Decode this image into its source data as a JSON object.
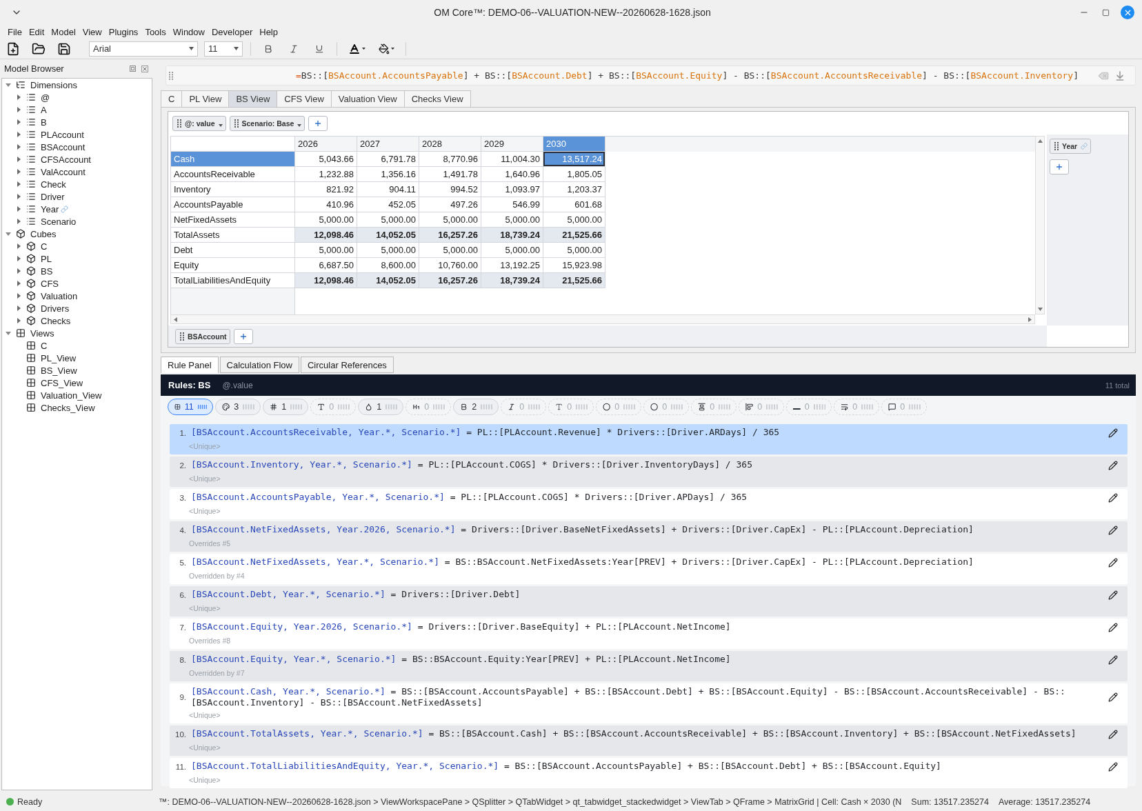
{
  "window": {
    "title": "OM Core™: DEMO-06--VALUATION-NEW--20260628-1628.json"
  },
  "menu": [
    "File",
    "Edit",
    "Model",
    "View",
    "Plugins",
    "Tools",
    "Window",
    "Developer",
    "Help"
  ],
  "toolbar": {
    "font": "Arial",
    "font_size": "11"
  },
  "model_browser": {
    "title": "Model Browser",
    "tree": [
      {
        "label": "Dimensions",
        "kind": "dimensions",
        "expanded": true,
        "children": [
          {
            "label": "@",
            "kind": "dimension",
            "expanded": false,
            "linked": false
          },
          {
            "label": "A",
            "kind": "dimension",
            "expanded": false,
            "linked": false
          },
          {
            "label": "B",
            "kind": "dimension",
            "expanded": false,
            "linked": false
          },
          {
            "label": "PLAccount",
            "kind": "dimension",
            "expanded": false,
            "linked": false
          },
          {
            "label": "BSAccount",
            "kind": "dimension",
            "expanded": false,
            "linked": false
          },
          {
            "label": "CFSAccount",
            "kind": "dimension",
            "expanded": false,
            "linked": false
          },
          {
            "label": "ValAccount",
            "kind": "dimension",
            "expanded": false,
            "linked": false
          },
          {
            "label": "Check",
            "kind": "dimension",
            "expanded": false,
            "linked": false
          },
          {
            "label": "Driver",
            "kind": "dimension",
            "expanded": false,
            "linked": false
          },
          {
            "label": "Year",
            "kind": "dimension",
            "expanded": false,
            "linked": true
          },
          {
            "label": "Scenario",
            "kind": "dimension",
            "expanded": false,
            "linked": false
          }
        ]
      },
      {
        "label": "Cubes",
        "kind": "cubes",
        "expanded": true,
        "children": [
          {
            "label": "C",
            "kind": "cube",
            "expanded": false
          },
          {
            "label": "PL",
            "kind": "cube",
            "expanded": false
          },
          {
            "label": "BS",
            "kind": "cube",
            "expanded": false
          },
          {
            "label": "CFS",
            "kind": "cube",
            "expanded": false
          },
          {
            "label": "Valuation",
            "kind": "cube",
            "expanded": false
          },
          {
            "label": "Drivers",
            "kind": "cube",
            "expanded": false
          },
          {
            "label": "Checks",
            "kind": "cube",
            "expanded": false
          }
        ]
      },
      {
        "label": "Views",
        "kind": "views",
        "expanded": true,
        "children": [
          {
            "label": "C",
            "kind": "view"
          },
          {
            "label": "PL_View",
            "kind": "view"
          },
          {
            "label": "BS_View",
            "kind": "view"
          },
          {
            "label": "CFS_View",
            "kind": "view"
          },
          {
            "label": "Valuation_View",
            "kind": "view"
          },
          {
            "label": "Checks_View",
            "kind": "view"
          }
        ]
      }
    ]
  },
  "formula_bar": {
    "tokens": [
      {
        "text": "=",
        "kind": "operator"
      },
      {
        "text": "BS::[",
        "kind": "plain"
      },
      {
        "text": "BSAccount.AccountsPayable",
        "kind": "reference"
      },
      {
        "text": "] + BS::[",
        "kind": "plain"
      },
      {
        "text": "BSAccount.Debt",
        "kind": "reference"
      },
      {
        "text": "] + BS::[",
        "kind": "plain"
      },
      {
        "text": "BSAccount.Equity",
        "kind": "reference"
      },
      {
        "text": "] - BS::[",
        "kind": "plain"
      },
      {
        "text": "BSAccount.AccountsReceivable",
        "kind": "reference"
      },
      {
        "text": "] - BS::[",
        "kind": "plain"
      },
      {
        "text": "BSAccount.Inventory",
        "kind": "reference"
      },
      {
        "text": "]",
        "kind": "plain"
      }
    ]
  },
  "view_tabs": [
    {
      "label": "C",
      "selected": false
    },
    {
      "label": "PL View",
      "selected": false
    },
    {
      "label": "BS View",
      "selected": true
    },
    {
      "label": "CFS View",
      "selected": false
    },
    {
      "label": "Valuation View",
      "selected": false
    },
    {
      "label": "Checks View",
      "selected": false
    }
  ],
  "pivot": {
    "filters": [
      {
        "label": "@: value"
      },
      {
        "label": "Scenario: Base"
      }
    ],
    "column_axis": [
      {
        "label": "Year",
        "linked": true
      }
    ],
    "row_axis": [
      {
        "label": "BSAccount"
      }
    ],
    "columns": [
      {
        "label": "2026",
        "selected": false
      },
      {
        "label": "2027",
        "selected": false
      },
      {
        "label": "2028",
        "selected": false
      },
      {
        "label": "2029",
        "selected": false
      },
      {
        "label": "2030",
        "selected": true
      }
    ],
    "rows": [
      {
        "label": "Cash",
        "selected": true,
        "total": false,
        "values": [
          "5,043.66",
          "6,791.78",
          "8,770.96",
          "11,004.30",
          "13,517.24"
        ]
      },
      {
        "label": "AccountsReceivable",
        "selected": false,
        "total": false,
        "values": [
          "1,232.88",
          "1,356.16",
          "1,491.78",
          "1,640.96",
          "1,805.05"
        ]
      },
      {
        "label": "Inventory",
        "selected": false,
        "total": false,
        "values": [
          "821.92",
          "904.11",
          "994.52",
          "1,093.97",
          "1,203.37"
        ]
      },
      {
        "label": "AccountsPayable",
        "selected": false,
        "total": false,
        "values": [
          "410.96",
          "452.05",
          "497.26",
          "546.99",
          "601.68"
        ]
      },
      {
        "label": "NetFixedAssets",
        "selected": false,
        "total": false,
        "values": [
          "5,000.00",
          "5,000.00",
          "5,000.00",
          "5,000.00",
          "5,000.00"
        ]
      },
      {
        "label": "TotalAssets",
        "selected": false,
        "total": true,
        "values": [
          "12,098.46",
          "14,052.05",
          "16,257.26",
          "18,739.24",
          "21,525.66"
        ]
      },
      {
        "label": "Debt",
        "selected": false,
        "total": false,
        "values": [
          "5,000.00",
          "5,000.00",
          "5,000.00",
          "5,000.00",
          "5,000.00"
        ]
      },
      {
        "label": "Equity",
        "selected": false,
        "total": false,
        "values": [
          "6,687.50",
          "8,600.00",
          "10,760.00",
          "13,192.25",
          "15,923.98"
        ]
      },
      {
        "label": "TotalLiabilitiesAndEquity",
        "selected": false,
        "total": true,
        "values": [
          "12,098.46",
          "14,052.05",
          "16,257.26",
          "18,739.24",
          "21,525.66"
        ]
      }
    ]
  },
  "bottom_tabs": [
    {
      "label": "Rule Panel",
      "selected": true
    },
    {
      "label": "Calculation Flow",
      "selected": false
    },
    {
      "label": "Circular References",
      "selected": false
    }
  ],
  "rules": {
    "title": "Rules: BS",
    "scope": "@.value",
    "total": "11 total",
    "filters": [
      {
        "kind": "grid",
        "count": "11",
        "selected": true,
        "disabled": false
      },
      {
        "kind": "palette",
        "count": "3",
        "selected": false,
        "disabled": false
      },
      {
        "kind": "number",
        "count": "1",
        "selected": false,
        "disabled": false
      },
      {
        "kind": "text",
        "count": "0",
        "selected": false,
        "disabled": true
      },
      {
        "kind": "fill",
        "count": "1",
        "selected": false,
        "disabled": false
      },
      {
        "kind": "heading",
        "count": "0",
        "selected": false,
        "disabled": true
      },
      {
        "kind": "bold",
        "count": "2",
        "selected": false,
        "disabled": false
      },
      {
        "kind": "italic",
        "count": "0",
        "selected": false,
        "disabled": true
      },
      {
        "kind": "font",
        "count": "0",
        "selected": false,
        "disabled": true
      },
      {
        "kind": "border",
        "count": "0",
        "selected": false,
        "disabled": true
      },
      {
        "kind": "shape",
        "count": "0",
        "selected": false,
        "disabled": true
      },
      {
        "kind": "valign",
        "count": "0",
        "selected": false,
        "disabled": true
      },
      {
        "kind": "halign",
        "count": "0",
        "selected": false,
        "disabled": true
      },
      {
        "kind": "underscore",
        "count": "0",
        "selected": false,
        "disabled": true
      },
      {
        "kind": "wrap",
        "count": "0",
        "selected": false,
        "disabled": true
      },
      {
        "kind": "comment",
        "count": "0",
        "selected": false,
        "disabled": true
      }
    ],
    "items": [
      {
        "number": "1.",
        "selector": "[BSAccount.AccountsReceivable, Year.*, Scenario.*]",
        "expression": "= PL::[PLAccount.Revenue] * Drivers::[Driver.ARDays] / 365",
        "note": "<Unique>",
        "selected": true
      },
      {
        "number": "2.",
        "selector": "[BSAccount.Inventory, Year.*, Scenario.*]",
        "expression": "= PL::[PLAccount.COGS] * Drivers::[Driver.InventoryDays] / 365",
        "note": "<Unique>",
        "selected": false
      },
      {
        "number": "3.",
        "selector": "[BSAccount.AccountsPayable, Year.*, Scenario.*]",
        "expression": "= PL::[PLAccount.COGS] * Drivers::[Driver.APDays] / 365",
        "note": "<Unique>",
        "selected": false
      },
      {
        "number": "4.",
        "selector": "[BSAccount.NetFixedAssets, Year.2026, Scenario.*]",
        "expression": "= Drivers::[Driver.BaseNetFixedAssets] + Drivers::[Driver.CapEx] - PL::[PLAccount.Depreciation]",
        "note": "Overrides #5",
        "selected": false
      },
      {
        "number": "5.",
        "selector": "[BSAccount.NetFixedAssets, Year.*, Scenario.*]",
        "expression": "= BS::BSAccount.NetFixedAssets:Year[PREV] + Drivers::[Driver.CapEx] - PL::[PLAccount.Depreciation]",
        "note": "Overridden by #4",
        "selected": false
      },
      {
        "number": "6.",
        "selector": "[BSAccount.Debt, Year.*, Scenario.*]",
        "expression": "= Drivers::[Driver.Debt]",
        "note": "<Unique>",
        "selected": false
      },
      {
        "number": "7.",
        "selector": "[BSAccount.Equity, Year.2026, Scenario.*]",
        "expression": "= Drivers::[Driver.BaseEquity] + PL::[PLAccount.NetIncome]",
        "note": "Overrides #8",
        "selected": false
      },
      {
        "number": "8.",
        "selector": "[BSAccount.Equity, Year.*, Scenario.*]",
        "expression": "= BS::BSAccount.Equity:Year[PREV] + PL::[PLAccount.NetIncome]",
        "note": "Overridden by #7",
        "selected": false
      },
      {
        "number": "9.",
        "selector": "[BSAccount.Cash, Year.*, Scenario.*]",
        "expression": "= BS::[BSAccount.AccountsPayable] + BS::[BSAccount.Debt] + BS::[BSAccount.Equity] - BS::[BSAccount.AccountsReceivable] - BS::[BSAccount.Inventory] - BS::[BSAccount.NetFixedAssets]",
        "note": "<Unique>",
        "selected": false
      },
      {
        "number": "10.",
        "selector": "[BSAccount.TotalAssets, Year.*, Scenario.*]",
        "expression": "= BS::[BSAccount.Cash] + BS::[BSAccount.AccountsReceivable] + BS::[BSAccount.Inventory] + BS::[BSAccount.NetFixedAssets]",
        "note": "<Unique>",
        "selected": false
      },
      {
        "number": "11.",
        "selector": "[BSAccount.TotalLiabilitiesAndEquity, Year.*, Scenario.*]",
        "expression": "= BS::[BSAccount.AccountsPayable] + BS::[BSAccount.Debt] + BS::[BSAccount.Equity]",
        "note": "<Unique>",
        "selected": false
      }
    ]
  },
  "status_bar": {
    "status": "Ready",
    "path": "™: DEMO-06--VALUATION-NEW--20260628-1628.json > ViewWorkspacePane > QSplitter > QTabWidget > qt_tabwidget_stackedwidget > ViewTab > QFrame > MatrixGrid | Cell: Cash × 2030 (N",
    "sum": "Sum: 13517.235274",
    "average": "Average: 13517.235274"
  }
}
